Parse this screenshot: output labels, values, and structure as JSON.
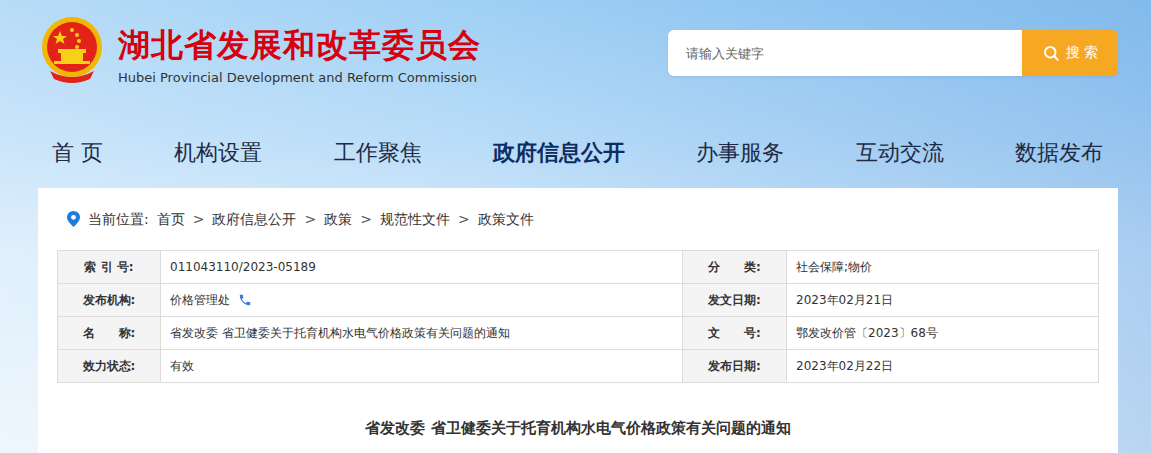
{
  "header": {
    "title": "湖北省发展和改革委员会",
    "subtitle": "Hubei Provincial Development and Reform Commission"
  },
  "search": {
    "placeholder": "请输入关键字",
    "button": "搜 索"
  },
  "nav": [
    {
      "label": "首 页",
      "selected": false
    },
    {
      "label": "机构设置",
      "selected": false
    },
    {
      "label": "工作聚焦",
      "selected": false
    },
    {
      "label": "政府信息公开",
      "selected": true
    },
    {
      "label": "办事服务",
      "selected": false
    },
    {
      "label": "互动交流",
      "selected": false
    },
    {
      "label": "数据发布",
      "selected": false
    }
  ],
  "breadcrumb": {
    "label": "当前位置:",
    "separator": ">",
    "items": [
      "首页",
      "政府信息公开",
      "政策",
      "规范性文件",
      "政策文件"
    ]
  },
  "info_table": {
    "rows": [
      [
        {
          "label": "索 引 号:",
          "value": "011043110/2023-05189",
          "phone": false
        },
        {
          "label": "分　　类:",
          "value": "社会保障;物价",
          "phone": false
        }
      ],
      [
        {
          "label": "发布机构:",
          "value": "价格管理处",
          "phone": true
        },
        {
          "label": "发文日期:",
          "value": "2023年02月21日",
          "phone": false
        }
      ],
      [
        {
          "label": "名　　称:",
          "value": "省发改委 省卫健委关于托育机构水电气价格政策有关问题的通知",
          "phone": false
        },
        {
          "label": "文　　号:",
          "value": "鄂发改价管〔2023〕68号",
          "phone": false
        }
      ],
      [
        {
          "label": "效力状态:",
          "value": "有效",
          "phone": false
        },
        {
          "label": "发布日期:",
          "value": "2023年02月22日",
          "phone": false
        }
      ]
    ]
  },
  "article": {
    "title": "省发改委 省卫健委关于托育机构水电气价格政策有关问题的通知"
  }
}
